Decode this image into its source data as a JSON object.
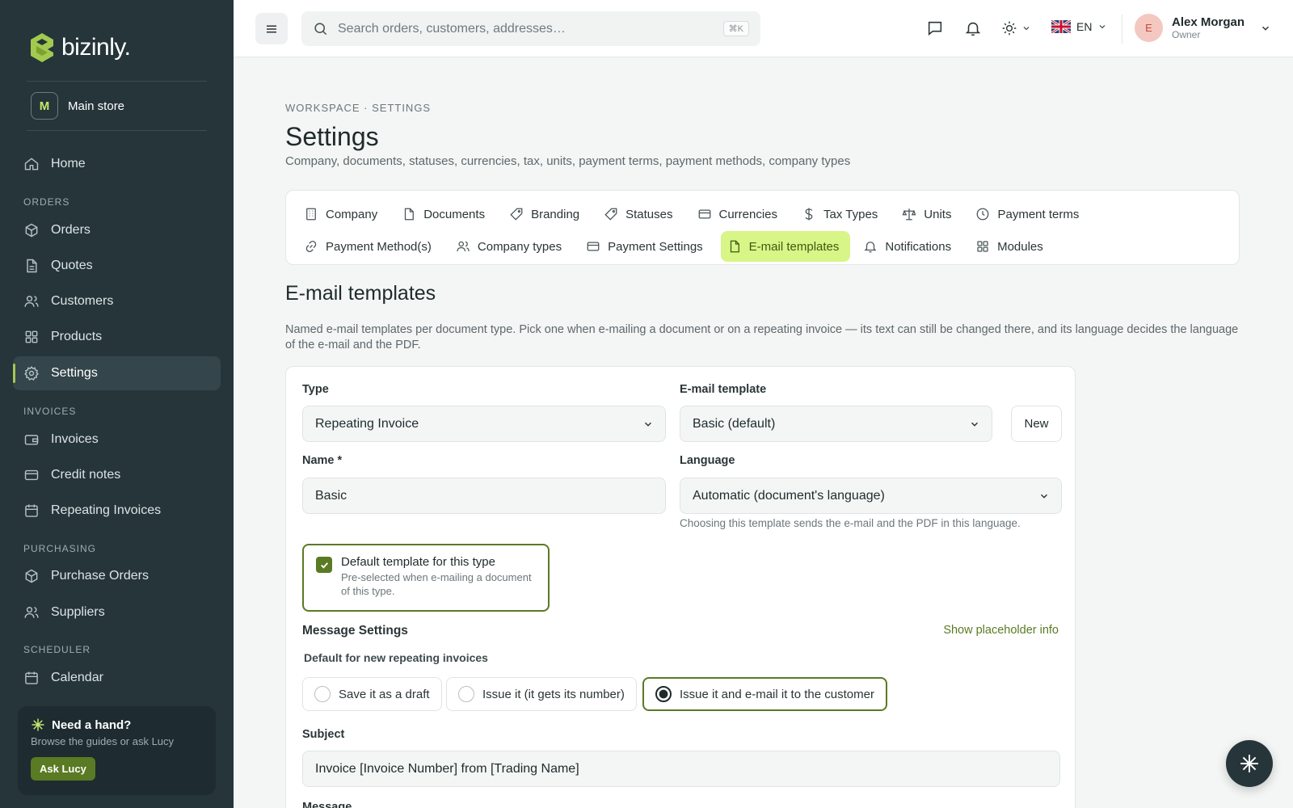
{
  "app": {
    "brand": "bizinly."
  },
  "sidebar": {
    "store": {
      "badge": "M",
      "label": "Main store"
    },
    "home": "Home",
    "sections": {
      "orders": "ORDERS",
      "invoices": "INVOICES",
      "purchasing": "PURCHASING",
      "scheduler": "SCHEDULER"
    },
    "items": {
      "orders": "Orders",
      "quotes": "Quotes",
      "customers": "Customers",
      "products": "Products",
      "settings": "Settings",
      "invoices": "Invoices",
      "credit_notes": "Credit notes",
      "repeating_invoices": "Repeating Invoices",
      "purchase_orders": "Purchase Orders",
      "suppliers": "Suppliers",
      "calendar": "Calendar"
    },
    "active": "settings",
    "help": {
      "title": "Need a hand?",
      "subtitle": "Browse the guides or ask Lucy",
      "button": "Ask Lucy"
    }
  },
  "topbar": {
    "search_placeholder": "Search orders, customers, addresses…",
    "shortcut": "⌘K",
    "language": "EN",
    "user": {
      "initial": "E",
      "name": "Alex Morgan",
      "role": "Owner"
    }
  },
  "page": {
    "breadcrumb": "WORKSPACE · SETTINGS",
    "title": "Settings",
    "subtitle": "Company, documents, statuses, currencies, tax, units, payment terms, payment methods, company types"
  },
  "tabs": {
    "company": "Company",
    "documents": "Documents",
    "branding": "Branding",
    "statuses": "Statuses",
    "currencies": "Currencies",
    "tax_types": "Tax Types",
    "units": "Units",
    "payment_terms": "Payment terms",
    "payment_methods": "Payment Method(s)",
    "company_types": "Company types",
    "payment_settings": "Payment Settings",
    "email_templates": "E-mail templates",
    "notifications": "Notifications",
    "modules": "Modules",
    "active": "email_templates"
  },
  "section": {
    "title": "E-mail templates",
    "description": "Named e-mail templates per document type. Pick one when e-mailing a document or on a repeating invoice — its text can still be changed there, and its language decides the language of the e-mail and the PDF."
  },
  "form": {
    "type": {
      "label": "Type",
      "value": "Repeating Invoice"
    },
    "template": {
      "label": "E-mail template",
      "value": "Basic (default)",
      "new_button": "New"
    },
    "name": {
      "label": "Name *",
      "value": "Basic"
    },
    "language": {
      "label": "Language",
      "value": "Automatic (document's language)",
      "hint": "Choosing this template sends the e-mail and the PDF in this language."
    },
    "default_template": {
      "checked": true,
      "title": "Default template for this type",
      "subtitle": "Pre-selected when e-mailing a document of this type."
    },
    "message_settings": {
      "title": "Message Settings",
      "placeholder_link": "Show placeholder info",
      "default_label": "Default for new repeating invoices",
      "options": [
        "Save it as a draft",
        "Issue it (it gets its number)",
        "Issue it and e-mail it to the customer"
      ],
      "selected_index": 2
    },
    "subject": {
      "label": "Subject",
      "value": "Invoice [Invoice Number] from [Trading Name]"
    },
    "message": {
      "label": "Message"
    }
  },
  "colors": {
    "sidebar": "#26353a",
    "accent": "#5a7a23",
    "active_tab": "#d8f587",
    "brand_logo": "#a3c94f"
  }
}
